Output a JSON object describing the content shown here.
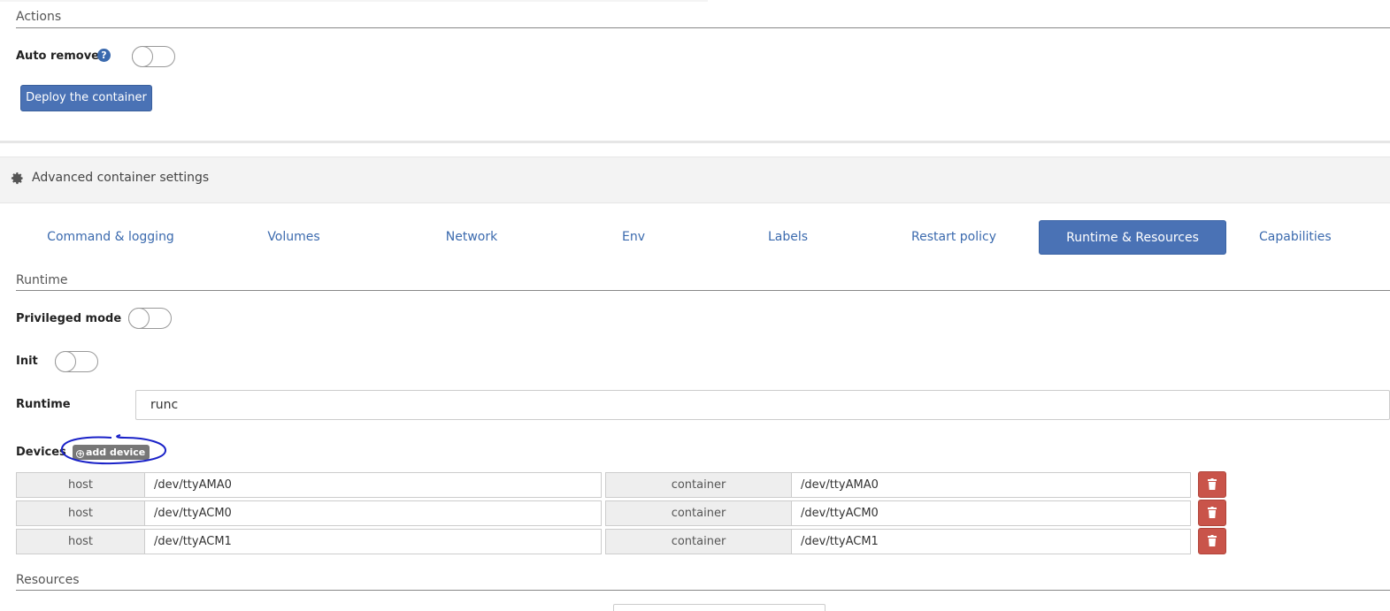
{
  "actions": {
    "section_title": "Actions",
    "auto_remove_label": "Auto remove",
    "auto_remove_enabled": false,
    "deploy_button": "Deploy the container"
  },
  "advanced": {
    "title": "Advanced container settings"
  },
  "tabs": [
    {
      "label": "Command & logging",
      "active": false
    },
    {
      "label": "Volumes",
      "active": false
    },
    {
      "label": "Network",
      "active": false
    },
    {
      "label": "Env",
      "active": false
    },
    {
      "label": "Labels",
      "active": false
    },
    {
      "label": "Restart policy",
      "active": false
    },
    {
      "label": "Runtime & Resources",
      "active": true
    },
    {
      "label": "Capabilities",
      "active": false
    }
  ],
  "runtime": {
    "section_title": "Runtime",
    "privileged_label": "Privileged mode",
    "privileged_enabled": false,
    "init_label": "Init",
    "init_enabled": false,
    "runtime_label": "Runtime",
    "runtime_value": "runc",
    "devices_label": "Devices",
    "add_device_label": "add device",
    "devices": [
      {
        "host_addon": "host",
        "host_value": "/dev/ttyAMA0",
        "container_addon": "container",
        "container_value": "/dev/ttyAMA0"
      },
      {
        "host_addon": "host",
        "host_value": "/dev/ttyACM0",
        "container_addon": "container",
        "container_value": "/dev/ttyACM0"
      },
      {
        "host_addon": "host",
        "host_value": "/dev/ttyACM1",
        "container_addon": "container",
        "container_value": "/dev/ttyACM1"
      }
    ]
  },
  "resources": {
    "section_title": "Resources"
  },
  "colors": {
    "primary": "#4a72b5",
    "danger": "#c9544a",
    "annotation": "#1a22c8"
  }
}
